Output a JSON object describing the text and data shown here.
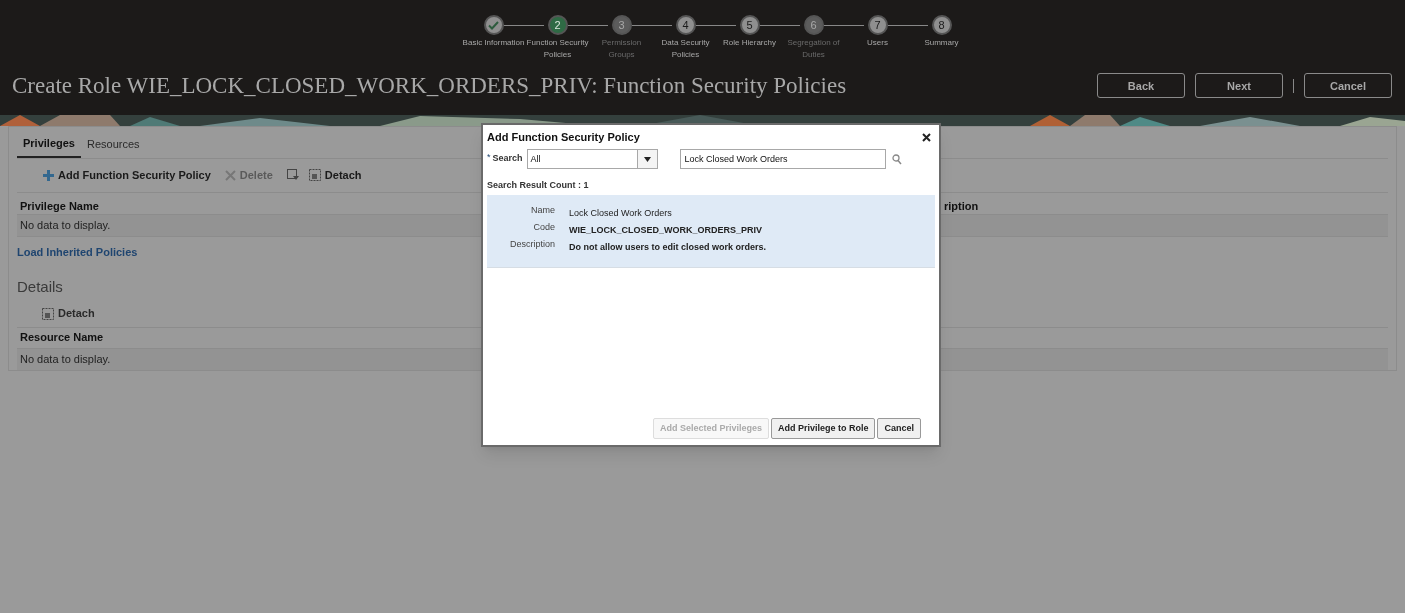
{
  "train": {
    "steps": [
      {
        "label": "Basic Information",
        "completed": true,
        "selected": false,
        "disabled": false
      },
      {
        "number": "2",
        "label": "Function Security Policies",
        "completed": false,
        "selected": true,
        "disabled": false
      },
      {
        "number": "3",
        "label": "Permission Groups",
        "completed": false,
        "selected": false,
        "disabled": true
      },
      {
        "number": "4",
        "label": "Data Security Policies",
        "completed": false,
        "selected": false,
        "disabled": false
      },
      {
        "number": "5",
        "label": "Role Hierarchy",
        "completed": false,
        "selected": false,
        "disabled": false
      },
      {
        "number": "6",
        "label": "Segregation of Duties",
        "completed": false,
        "selected": false,
        "disabled": true
      },
      {
        "number": "7",
        "label": "Users",
        "completed": false,
        "selected": false,
        "disabled": false
      },
      {
        "number": "8",
        "label": "Summary",
        "completed": false,
        "selected": false,
        "disabled": false
      }
    ]
  },
  "page": {
    "title": "Create Role WIE_LOCK_CLOSED_WORK_ORDERS_PRIV: Function Security Policies",
    "buttons": [
      "Back",
      "Next",
      "Cancel"
    ]
  },
  "tabs": [
    {
      "label": "Privileges",
      "selected": true
    },
    {
      "label": "Resources",
      "selected": false
    }
  ],
  "toolbar": [
    {
      "kind": "add",
      "label": "Add Function Security Policy",
      "disabled": false
    },
    {
      "kind": "delete",
      "label": "Delete",
      "disabled": true
    },
    {
      "kind": "export"
    },
    {
      "kind": "detach",
      "label": "Detach",
      "disabled": false
    }
  ],
  "privileges_table": {
    "columns": [
      "Privilege Name",
      "ription"
    ],
    "empty": "No data to display."
  },
  "load_link": "Load Inherited Policies",
  "details": {
    "heading": "Details",
    "detach": "Detach",
    "columns": [
      "Resource Name"
    ],
    "empty": "No data to display."
  },
  "dialog": {
    "title": "Add Function Security Policy",
    "required_mark": "*",
    "search_label": "Search",
    "search_scope": "All",
    "search_value": "Lock Closed Work Orders",
    "result_count": "Search Result Count : 1",
    "results": [
      {
        "selected": true,
        "fields": [
          {
            "label": "Name",
            "value": "Lock Closed Work Orders"
          },
          {
            "label": "Code",
            "value": "WIE_LOCK_CLOSED_WORK_ORDERS_PRIV"
          },
          {
            "label": "Description",
            "value": "Do not allow users to edit closed work orders."
          }
        ]
      }
    ],
    "buttons": [
      {
        "label": "Add Selected Privileges",
        "disabled": true
      },
      {
        "label": "Add Privilege to Role",
        "disabled": false
      },
      {
        "label": "Cancel",
        "disabled": false
      }
    ]
  }
}
